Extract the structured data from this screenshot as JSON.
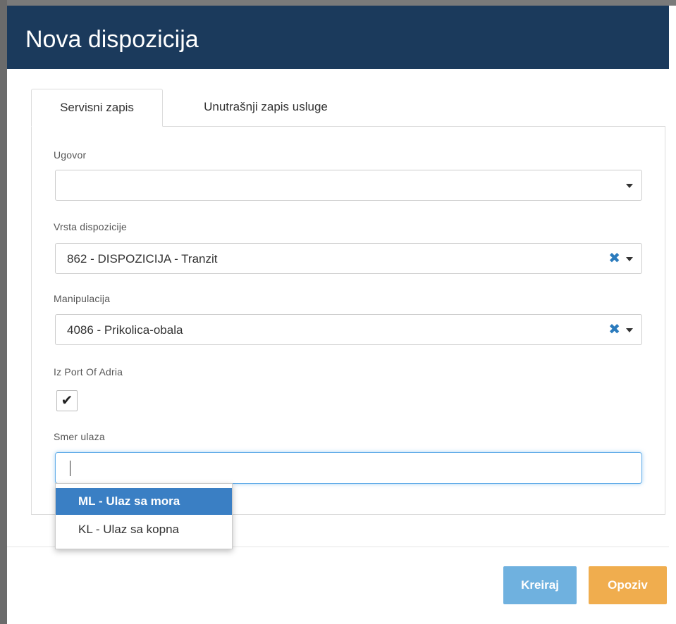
{
  "dialog": {
    "title": "Nova dispozicija"
  },
  "tabs": [
    {
      "label": "Servisni zapis",
      "active": true
    },
    {
      "label": "Unutrašnji zapis usluge",
      "active": false
    }
  ],
  "form": {
    "ugovor": {
      "label": "Ugovor",
      "value": ""
    },
    "vrsta_dispozicije": {
      "label": "Vrsta dispozicije",
      "value": "862 - DISPOZICIJA - Tranzit"
    },
    "manipulacija": {
      "label": "Manipulacija",
      "value": "4086 - Prikolica-obala"
    },
    "iz_port_of_adria": {
      "label": "Iz Port Of Adria",
      "checked": true,
      "check_glyph": "✔"
    },
    "smer_ulaza": {
      "label": "Smer ulaza",
      "value": "",
      "options": [
        "ML - Ulaz sa mora",
        "KL - Ulaz sa kopna"
      ],
      "highlighted_index": 0
    }
  },
  "icons": {
    "clear": "✖",
    "clear_color": "#2b7bbd",
    "caret": "chevron-down-icon"
  },
  "footer": {
    "create_label": "Kreiraj",
    "cancel_label": "Opoziv"
  },
  "colors": {
    "header_bg": "#1b3a5c",
    "create_btn": "#6fb1df",
    "cancel_btn": "#f0ad4e",
    "highlight": "#3a7fc4"
  }
}
